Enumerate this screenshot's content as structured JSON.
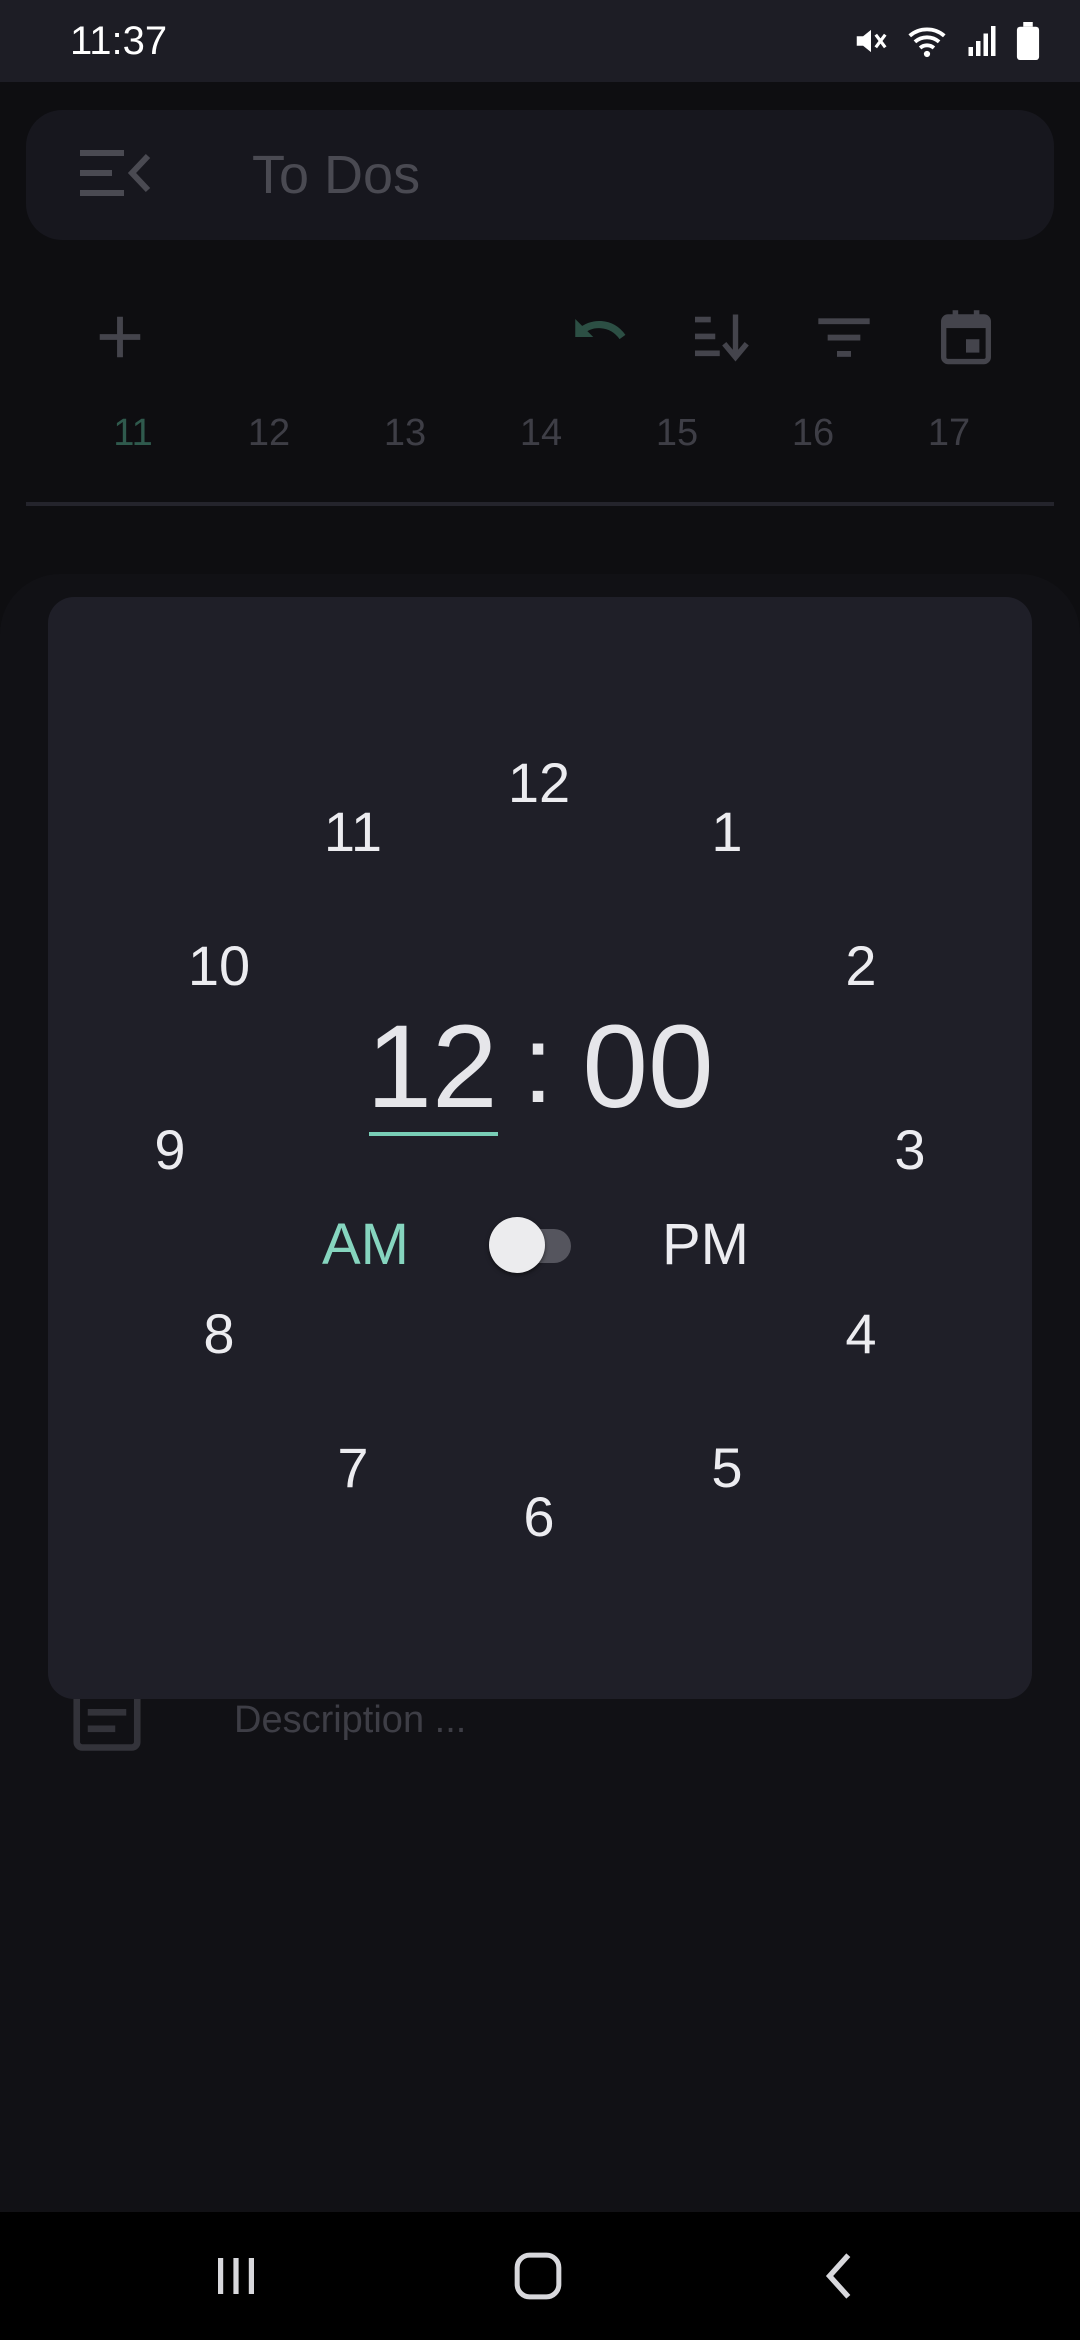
{
  "status_bar": {
    "time": "11:37",
    "icons": [
      "mute-icon",
      "wifi-icon",
      "signal-icon",
      "battery-icon"
    ]
  },
  "app": {
    "title": "To Dos",
    "toolbar": [
      "add-icon",
      "undo-icon",
      "sort-icon",
      "filter-icon",
      "calendar-icon"
    ],
    "dates": [
      "11",
      "12",
      "13",
      "14",
      "15",
      "16",
      "17"
    ],
    "selected_date": "11",
    "description_placeholder": "Description ..."
  },
  "time_picker": {
    "hour": "12",
    "separator": ":",
    "minute": "00",
    "am_label": "AM",
    "pm_label": "PM",
    "period_selected": "AM",
    "dial": [
      "12",
      "1",
      "2",
      "3",
      "4",
      "5",
      "6",
      "7",
      "8",
      "9",
      "10",
      "11"
    ]
  },
  "colors": {
    "accent": "#78cdb6",
    "dialog_bg": "#1f1f28",
    "screen_bg": "#0e0e11"
  },
  "nav_bar": {
    "buttons": [
      "recent-apps-icon",
      "home-icon",
      "back-icon"
    ]
  }
}
